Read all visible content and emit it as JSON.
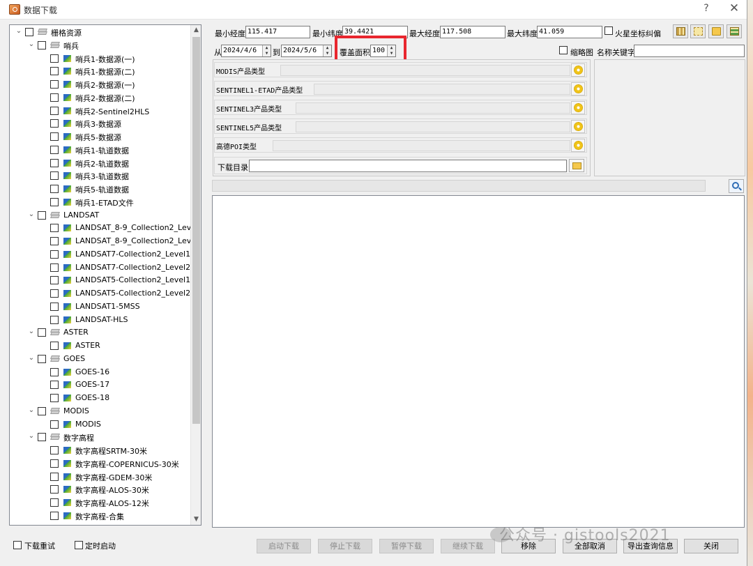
{
  "window": {
    "title": "数据下载",
    "help": "?",
    "close": "✕"
  },
  "tree": {
    "rows": [
      {
        "level": 0,
        "type": "group",
        "expanded": true,
        "label": "栅格资源"
      },
      {
        "level": 1,
        "type": "group",
        "expanded": true,
        "label": "哨兵"
      },
      {
        "level": 2,
        "type": "item",
        "label": "哨兵1-数据源(一)"
      },
      {
        "level": 2,
        "type": "item",
        "label": "哨兵1-数据源(二)"
      },
      {
        "level": 2,
        "type": "item",
        "label": "哨兵2-数据源(一)"
      },
      {
        "level": 2,
        "type": "item",
        "label": "哨兵2-数据源(二)"
      },
      {
        "level": 2,
        "type": "item",
        "label": "哨兵2-Sentinel2HLS"
      },
      {
        "level": 2,
        "type": "item",
        "label": "哨兵3-数据源"
      },
      {
        "level": 2,
        "type": "item",
        "label": "哨兵5-数据源"
      },
      {
        "level": 2,
        "type": "item",
        "label": "哨兵1-轨道数据"
      },
      {
        "level": 2,
        "type": "item",
        "label": "哨兵2-轨道数据"
      },
      {
        "level": 2,
        "type": "item",
        "label": "哨兵3-轨道数据"
      },
      {
        "level": 2,
        "type": "item",
        "label": "哨兵5-轨道数据"
      },
      {
        "level": 2,
        "type": "item",
        "label": "哨兵1-ETAD文件"
      },
      {
        "level": 1,
        "type": "group",
        "expanded": true,
        "label": "LANDSAT"
      },
      {
        "level": 2,
        "type": "item",
        "label": "LANDSAT_8-9_Collection2_Lev..."
      },
      {
        "level": 2,
        "type": "item",
        "label": "LANDSAT_8-9_Collection2_Lev..."
      },
      {
        "level": 2,
        "type": "item",
        "label": "LANDSAT7-Collection2_Level1"
      },
      {
        "level": 2,
        "type": "item",
        "label": "LANDSAT7-Collection2_Level2"
      },
      {
        "level": 2,
        "type": "item",
        "label": "LANDSAT5-Collection2_Level1"
      },
      {
        "level": 2,
        "type": "item",
        "label": "LANDSAT5-Collection2_Level2"
      },
      {
        "level": 2,
        "type": "item",
        "label": "LANDSAT1-5MSS"
      },
      {
        "level": 2,
        "type": "item",
        "label": "LANDSAT-HLS"
      },
      {
        "level": 1,
        "type": "group",
        "expanded": true,
        "label": "ASTER"
      },
      {
        "level": 2,
        "type": "item",
        "label": "ASTER"
      },
      {
        "level": 1,
        "type": "group",
        "expanded": true,
        "label": "GOES"
      },
      {
        "level": 2,
        "type": "item",
        "label": "GOES-16"
      },
      {
        "level": 2,
        "type": "item",
        "label": "GOES-17"
      },
      {
        "level": 2,
        "type": "item",
        "label": "GOES-18"
      },
      {
        "level": 1,
        "type": "group",
        "expanded": true,
        "label": "MODIS"
      },
      {
        "level": 2,
        "type": "item",
        "label": "MODIS"
      },
      {
        "level": 1,
        "type": "group",
        "expanded": true,
        "label": "数字高程"
      },
      {
        "level": 2,
        "type": "item",
        "label": "数字高程SRTM-30米"
      },
      {
        "level": 2,
        "type": "item",
        "label": "数字高程-COPERNICUS-30米"
      },
      {
        "level": 2,
        "type": "item",
        "label": "数字高程-GDEM-30米"
      },
      {
        "level": 2,
        "type": "item",
        "label": "数字高程-ALOS-30米"
      },
      {
        "level": 2,
        "type": "item",
        "label": "数字高程-ALOS-12米"
      },
      {
        "level": 2,
        "type": "item",
        "label": "数字高程-合集"
      }
    ],
    "scroll_up": "▲",
    "scroll_down": "▼"
  },
  "coords": {
    "min_lon_label": "最小经度",
    "min_lon_value": "115.417",
    "min_lat_label": "最小纬度",
    "min_lat_value": "39.4421",
    "max_lon_label": "最大经度",
    "max_lon_value": "117.508",
    "max_lat_label": "最大纬度",
    "max_lat_value": "41.059",
    "mars_label": "火星坐标纠偏"
  },
  "filter": {
    "from_label": "从",
    "from_value": "2024/4/6",
    "to_label": "到",
    "to_value": "2024/5/6",
    "cover_label": "覆盖面积",
    "cover_value": "100",
    "thumb_label": "缩略图",
    "keyword_label": "名称关键字",
    "keyword_value": ""
  },
  "product_types": [
    {
      "label": "MODIS产品类型"
    },
    {
      "label": "SENTINEL1-ETAD产品类型"
    },
    {
      "label": "SENTINEL3产品类型"
    },
    {
      "label": "SENTINEL5产品类型"
    },
    {
      "label": "高德POI类型"
    }
  ],
  "download_dir": {
    "label": "下载目录",
    "value": ""
  },
  "bottom": {
    "retry_label": "下载重试",
    "timer_label": "定时启动",
    "buttons": [
      {
        "label": "启动下载",
        "enabled": false
      },
      {
        "label": "停止下载",
        "enabled": false
      },
      {
        "label": "暂停下载",
        "enabled": false
      },
      {
        "label": "继续下载",
        "enabled": false
      },
      {
        "label": "移除",
        "enabled": true
      },
      {
        "label": "全部取消",
        "enabled": true
      },
      {
        "label": "导出查询信息",
        "enabled": true
      },
      {
        "label": "关闭",
        "enabled": true
      }
    ]
  },
  "watermark": "公众号 · gistools2021",
  "colors": {
    "highlight_box": "#e8262e",
    "panel_bg": "#f0f0f0"
  }
}
